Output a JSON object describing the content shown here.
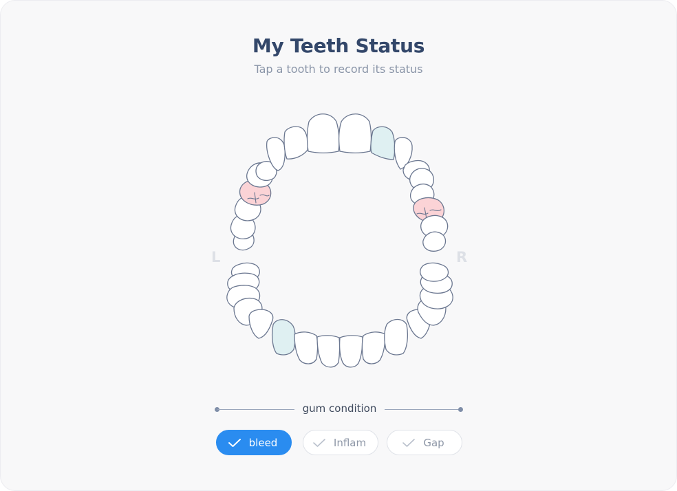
{
  "page": {
    "title": "My Teeth Status",
    "subtitle": "Tap a tooth to record its status"
  },
  "chart_labels": {
    "left": "L",
    "right": "R"
  },
  "colors": {
    "accent": "#2a8cf0",
    "bleed_fill": "#dff0f2",
    "inflam_fill": "#fbd3d6",
    "tooth_outline": "#6b7790"
  },
  "teeth_status": {
    "upper_left_canine": "bleed",
    "lower_left_canine": "bleed",
    "upper_left_molar": "inflam",
    "upper_right_molar": "inflam"
  },
  "gum_condition": {
    "label": "gum condition",
    "options": [
      {
        "label": "bleed",
        "selected": true,
        "icon": "check-icon"
      },
      {
        "label": "Inflam",
        "selected": false,
        "icon": "check-icon"
      },
      {
        "label": "Gap",
        "selected": false,
        "icon": "check-icon"
      }
    ]
  }
}
